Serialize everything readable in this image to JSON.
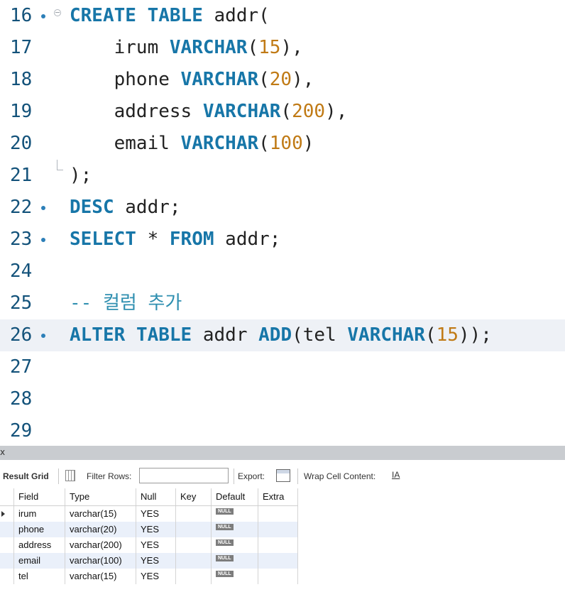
{
  "editor": {
    "lines": [
      {
        "n": "16",
        "dot": true,
        "fold": "open",
        "tokens": [
          [
            "kw",
            "CREATE"
          ],
          [
            "t",
            " "
          ],
          [
            "kw",
            "TABLE"
          ],
          [
            "t",
            " addr("
          ]
        ]
      },
      {
        "n": "17",
        "tokens": [
          [
            "t",
            "    irum "
          ],
          [
            "kw",
            "VARCHAR"
          ],
          [
            "t",
            "("
          ],
          [
            "num",
            "15"
          ],
          [
            "t",
            "),"
          ]
        ]
      },
      {
        "n": "18",
        "tokens": [
          [
            "t",
            "    phone "
          ],
          [
            "kw",
            "VARCHAR"
          ],
          [
            "t",
            "("
          ],
          [
            "num",
            "20"
          ],
          [
            "t",
            "),"
          ]
        ]
      },
      {
        "n": "19",
        "tokens": [
          [
            "t",
            "    address "
          ],
          [
            "kw",
            "VARCHAR"
          ],
          [
            "t",
            "("
          ],
          [
            "num",
            "200"
          ],
          [
            "t",
            "),"
          ]
        ]
      },
      {
        "n": "20",
        "tokens": [
          [
            "t",
            "    email "
          ],
          [
            "kw",
            "VARCHAR"
          ],
          [
            "t",
            "("
          ],
          [
            "num",
            "100"
          ],
          [
            "t",
            ")"
          ]
        ]
      },
      {
        "n": "21",
        "fold": "close",
        "tokens": [
          [
            "t",
            ");"
          ]
        ]
      },
      {
        "n": "22",
        "dot": true,
        "tokens": [
          [
            "kw",
            "DESC"
          ],
          [
            "t",
            " addr;"
          ]
        ]
      },
      {
        "n": "23",
        "dot": true,
        "tokens": [
          [
            "kw",
            "SELECT"
          ],
          [
            "t",
            " * "
          ],
          [
            "kw",
            "FROM"
          ],
          [
            "t",
            " addr;"
          ]
        ]
      },
      {
        "n": "24",
        "tokens": []
      },
      {
        "n": "25",
        "tokens": [
          [
            "cmt",
            "-- 컬럼 추가"
          ]
        ]
      },
      {
        "n": "26",
        "dot": true,
        "highlight": true,
        "tokens": [
          [
            "kw",
            "ALTER"
          ],
          [
            "t",
            " "
          ],
          [
            "kw",
            "TABLE"
          ],
          [
            "t",
            " addr "
          ],
          [
            "kw",
            "ADD"
          ],
          [
            "t",
            "(tel "
          ],
          [
            "kw",
            "VARCHAR"
          ],
          [
            "t",
            "("
          ],
          [
            "num",
            "15"
          ],
          [
            "t",
            "));"
          ]
        ]
      },
      {
        "n": "27",
        "tokens": []
      },
      {
        "n": "28",
        "tokens": []
      },
      {
        "n": "29",
        "tokens": []
      }
    ]
  },
  "splitter": {
    "close_glyph": "x"
  },
  "toolbar": {
    "result_grid": "Result Grid",
    "filter_rows": "Filter Rows:",
    "filter_value": "",
    "export": "Export:",
    "wrap": "Wrap Cell Content:",
    "wrap_icon": "IA"
  },
  "grid": {
    "columns": [
      "Field",
      "Type",
      "Null",
      "Key",
      "Default",
      "Extra"
    ],
    "null_label": "NULL",
    "rows": [
      [
        "irum",
        "varchar(15)",
        "YES",
        "",
        "NULL",
        ""
      ],
      [
        "phone",
        "varchar(20)",
        "YES",
        "",
        "NULL",
        ""
      ],
      [
        "address",
        "varchar(200)",
        "YES",
        "",
        "NULL",
        ""
      ],
      [
        "email",
        "varchar(100)",
        "YES",
        "",
        "NULL",
        ""
      ],
      [
        "tel",
        "varchar(15)",
        "YES",
        "",
        "NULL",
        ""
      ]
    ]
  },
  "colors": {
    "keyword": "#1776a8",
    "number": "#c07a15",
    "line_number": "#13527a",
    "highlight": "#eef1f6"
  }
}
